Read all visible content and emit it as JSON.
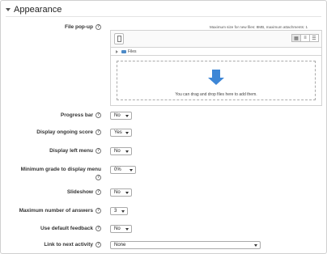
{
  "section": {
    "title": "Appearance"
  },
  "file_popup": {
    "label": "File pop-up",
    "max_size_text": "Maximum size for new files: 8MB, maximum attachments: 1",
    "path_label": "Files",
    "drop_text": "You can drag and drop files here to add them."
  },
  "fields": {
    "progress_bar": {
      "label": "Progress bar",
      "value": "No"
    },
    "ongoing_score": {
      "label": "Display ongoing score",
      "value": "Yes"
    },
    "left_menu": {
      "label": "Display left menu",
      "value": "No"
    },
    "min_grade_line1": "Minimum grade to display menu",
    "min_grade": {
      "value": "0%"
    },
    "slideshow": {
      "label": "Slideshow",
      "value": "No"
    },
    "max_answers": {
      "label": "Maximum number of answers",
      "value": "3"
    },
    "default_feedback": {
      "label": "Use default feedback",
      "value": "No"
    },
    "next_activity": {
      "label": "Link to next activity",
      "value": "None"
    }
  },
  "help_glyph": "?"
}
